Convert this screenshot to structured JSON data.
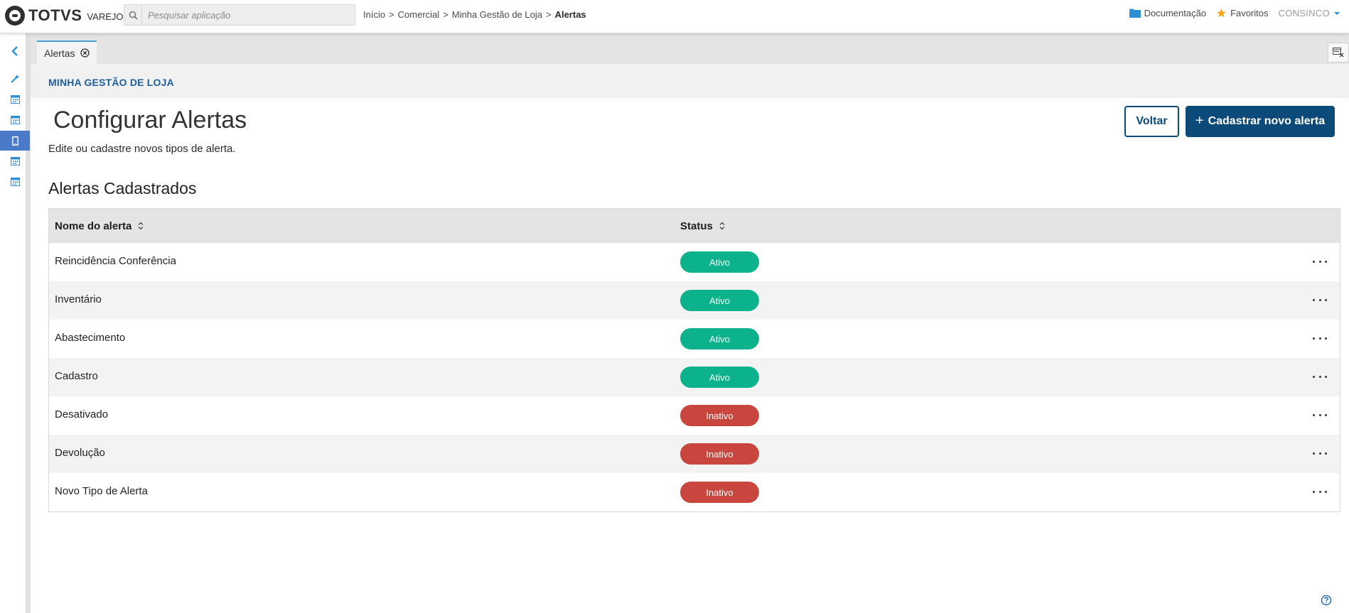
{
  "brand": {
    "name": "TOTVS",
    "product": "VAREJO"
  },
  "search": {
    "placeholder": "Pesquisar aplicação"
  },
  "breadcrumb": {
    "items": [
      "Início",
      "Comercial",
      "Minha Gestão de Loja"
    ],
    "current": "Alertas",
    "separator": ">"
  },
  "topright": {
    "docs": "Documentação",
    "favorites": "Favoritos",
    "user": "CONSINCO"
  },
  "tab": {
    "label": "Alertas"
  },
  "section": {
    "title": "MINHA GESTÃO DE LOJA"
  },
  "page": {
    "title": "Configurar Alertas",
    "subtitle": "Edite ou cadastre novos tipos de alerta.",
    "back_label": "Voltar",
    "new_label": "Cadastrar novo alerta",
    "list_title": "Alertas Cadastrados"
  },
  "table": {
    "columns": {
      "name": "Nome do alerta",
      "status": "Status"
    },
    "rows": [
      {
        "name": "Reincidência Conferência",
        "status": "Ativo"
      },
      {
        "name": "Inventário",
        "status": "Ativo"
      },
      {
        "name": "Abastecimento",
        "status": "Ativo"
      },
      {
        "name": "Cadastro",
        "status": "Ativo"
      },
      {
        "name": "Desativado",
        "status": "Inativo"
      },
      {
        "name": "Devolução",
        "status": "Inativo"
      },
      {
        "name": "Novo Tipo de Alerta",
        "status": "Inativo"
      }
    ]
  },
  "colors": {
    "primary": "#0c4a7a",
    "active": "#0bb28b",
    "inactive": "#c8463d",
    "sidebar_active": "#4a7ac8"
  }
}
